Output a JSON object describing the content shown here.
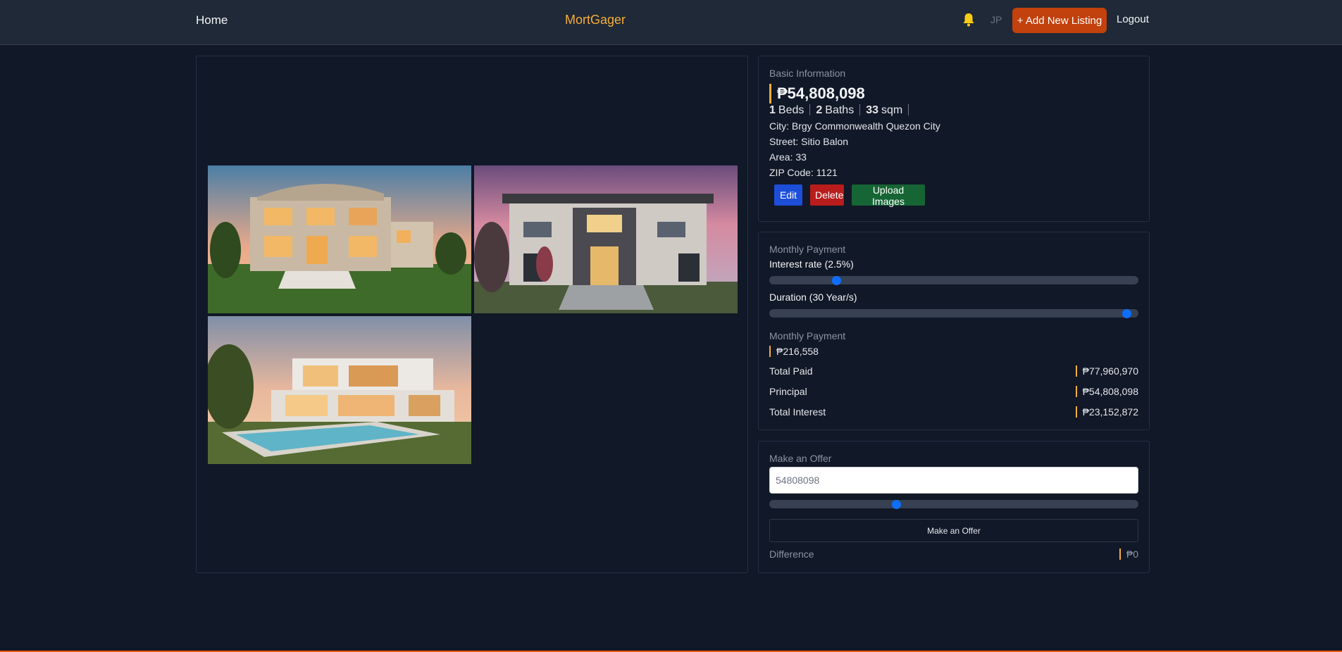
{
  "nav": {
    "home": "Home",
    "brand": "MortGager",
    "initials": "JP",
    "add_listing": "+ Add New Listing",
    "logout": "Logout"
  },
  "basic": {
    "title": "Basic Information",
    "price": "₱54,808,098",
    "beds_num": "1",
    "beds_label": "Beds",
    "baths_num": "2",
    "baths_label": "Baths",
    "area_num": "33",
    "area_label": "sqm",
    "city": "City: Brgy Commonwealth Quezon City",
    "street": "Street: Sitio Balon",
    "area": "Area: 33",
    "zip": "ZIP Code: 1121",
    "edit": "Edit",
    "delete": "Delete",
    "upload": "Upload Images"
  },
  "monthly": {
    "title": "Monthly Payment",
    "interest_label": "Interest rate (2.5%)",
    "interest_position": 0.175,
    "duration_label": "Duration (30 Year/s)",
    "duration_position": 0.98,
    "payment_label": "Monthly Payment",
    "payment_value": "₱216,558",
    "rows": [
      {
        "label": "Total Paid",
        "value": "₱77,960,970"
      },
      {
        "label": "Principal",
        "value": "₱54,808,098"
      },
      {
        "label": "Total Interest",
        "value": "₱23,152,872"
      }
    ]
  },
  "offer": {
    "title": "Make an Offer",
    "input_value": "54808098",
    "slider_position": 0.34,
    "button": "Make an Offer",
    "difference_label": "Difference",
    "difference_value": "₱0"
  },
  "colors": {
    "accent": "#f6ad3b",
    "add_button": "#c2410c",
    "edit": "#1d4ed8",
    "delete": "#b91c1c",
    "upload": "#166534",
    "slider": "#0d6efd"
  }
}
